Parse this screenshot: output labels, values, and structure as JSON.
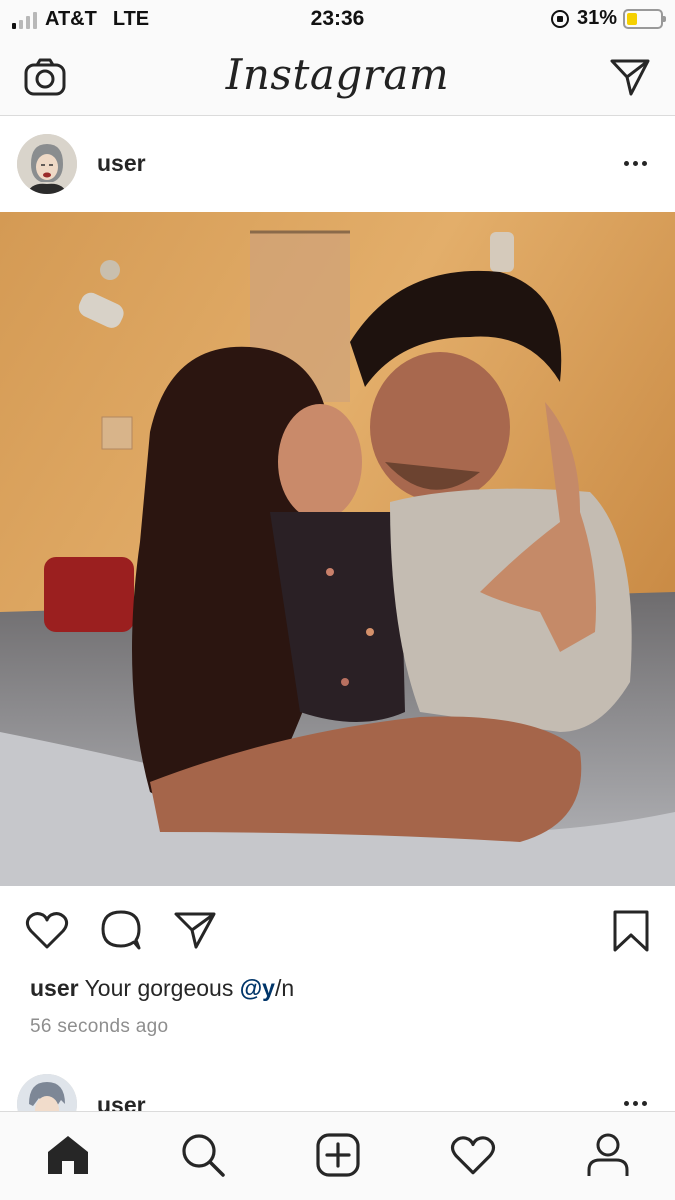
{
  "status_bar": {
    "carrier": "AT&T",
    "network": "LTE",
    "time": "23:36",
    "battery_percent": "31%",
    "battery_level": 0.31,
    "battery_color": "#f5d000"
  },
  "header": {
    "logo_text": "Instagram",
    "left_icon": "camera-icon",
    "right_icon": "direct-message-icon"
  },
  "post": {
    "username": "user",
    "more_icon": "more-options-icon",
    "actions": {
      "like_icon": "heart-icon",
      "comment_icon": "comment-icon",
      "share_icon": "share-icon",
      "save_icon": "bookmark-icon"
    },
    "caption": {
      "username": "user",
      "text": "Your gorgeous",
      "mention": "@y",
      "mention_suffix": "/n"
    },
    "time_ago": "56 seconds ago"
  },
  "next_post": {
    "username": "user"
  },
  "tab_bar": {
    "items": [
      "home-icon",
      "search-icon",
      "add-post-icon",
      "activity-heart-icon",
      "profile-icon"
    ],
    "active": "home-icon"
  },
  "colors": {
    "text": "#262626",
    "muted": "#8e8e8e",
    "mention": "#003569",
    "bar_background": "#fafafa",
    "divider": "#dbdbdb"
  }
}
